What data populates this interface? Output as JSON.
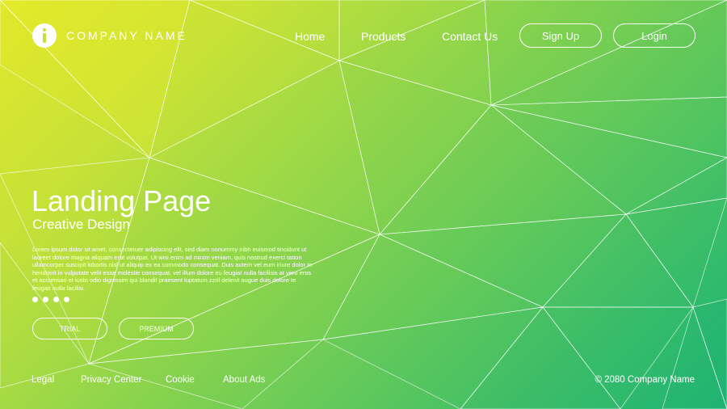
{
  "brand": {
    "name": "COMPANY NAME",
    "logo_icon": "info-icon"
  },
  "nav": {
    "home": "Home",
    "products": "Products",
    "contact": "Contact Us"
  },
  "auth": {
    "signup": "Sign Up",
    "login": "Login"
  },
  "hero": {
    "title": "Landing Page",
    "subtitle": "Creative Design",
    "body": "Lorem ipsum dolor sit amet, consectetuer adipiscing elit, sed diam nonummy nibh euismod tincidunt ut laoreet dolore magna aliquam erat volutpat. Ut wisi enim ad minim veniam, quis nostrud exerci tation ullamcorper suscipit lobortis nisl ut aliquip ex ea commodo consequat. Duis autem vel eum iriure dolor in hendrerit in vulputate velit esse molestie consequat, vel illum dolore eu feugiat nulla facilisis at vero eros et accumsan et iusto odio dignissim qui blandit praesent luptatum zzril delenit augue duis dolore te feugait nulla facilisi.",
    "trial": "TRIAL",
    "premium": "PREMIUM"
  },
  "footer": {
    "legal": "Legal",
    "privacy": "Privacy Center",
    "cookie": "Cookie",
    "about_ads": "About Ads",
    "copyright": "© 2080 Company Name"
  },
  "colors": {
    "gradient_start": "#e2e82b",
    "gradient_mid": "#8fd54c",
    "gradient_end": "#1eb473",
    "text": "#ffffff"
  }
}
